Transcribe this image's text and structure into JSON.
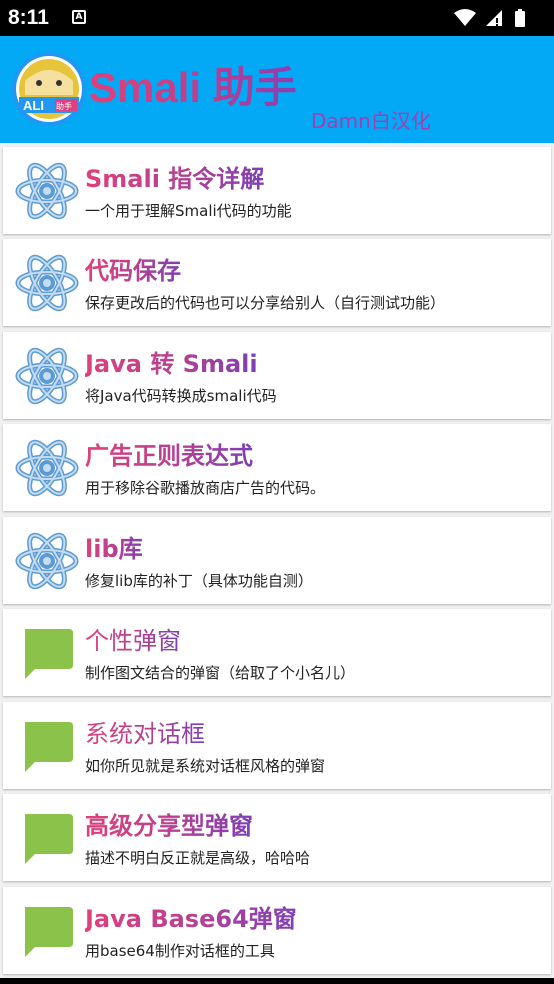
{
  "status_bar": {
    "time": "8:11",
    "notification_icon": "A",
    "icons": [
      "wifi-icon",
      "signal-icon",
      "battery-icon"
    ]
  },
  "app_bar": {
    "title": "Smali 助手",
    "subtitle": "Damn白汉化",
    "logo_text": "ALI",
    "logo_badge": "助手",
    "background": "#03a9f4"
  },
  "items": [
    {
      "icon": "atom-icon",
      "title": "Smali 指令详解",
      "desc": "一个用于理解Smali代码的功能",
      "bold": true
    },
    {
      "icon": "atom-icon",
      "title": "代码保存",
      "desc": "保存更改后的代码也可以分享给别人（自行测试功能）",
      "bold": true
    },
    {
      "icon": "atom-icon",
      "title": "Java 转 Smali",
      "desc": "将Java代码转换成smali代码",
      "bold": true
    },
    {
      "icon": "atom-icon",
      "title": "广告正则表达式",
      "desc": "用于移除谷歌播放商店广告的代码。",
      "bold": true
    },
    {
      "icon": "atom-icon",
      "title": "lib库",
      "desc": "修复lib库的补丁（具体功能自测）",
      "bold": true
    },
    {
      "icon": "chat-bubble-icon",
      "title": "个性弹窗",
      "desc": "制作图文结合的弹窗（给取了个小名儿）",
      "bold": false
    },
    {
      "icon": "chat-bubble-icon",
      "title": "系统对话框",
      "desc": "如你所见就是系统对话框风格的弹窗",
      "bold": false
    },
    {
      "icon": "chat-bubble-icon",
      "title": "高级分享型弹窗",
      "desc": "描述不明白反正就是高级，哈哈哈",
      "bold": true
    },
    {
      "icon": "chat-bubble-icon",
      "title": "Java Base64弹窗",
      "desc": "用base64制作对话框的工具",
      "bold": true
    }
  ],
  "colors": {
    "title_gradient_start": "#e0407a",
    "title_gradient_end": "#7d3fb5",
    "atom": "#5b9bd5",
    "bubble": "#8bc34a"
  }
}
